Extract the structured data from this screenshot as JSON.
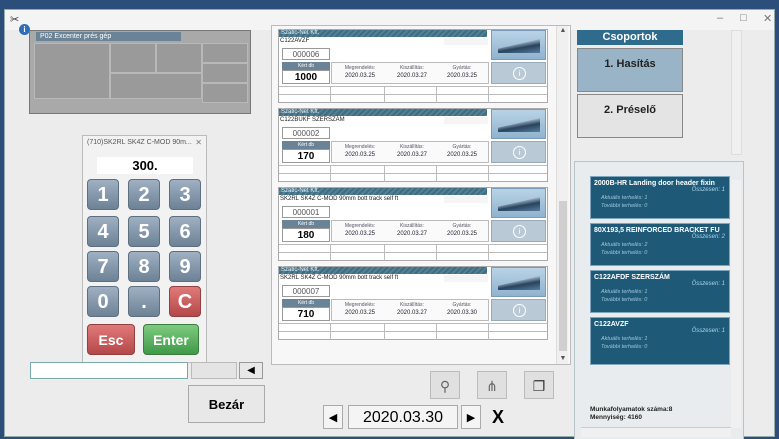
{
  "window": {
    "minimize_glyph": "–",
    "maximize_glyph": "□",
    "close_glyph": "✕"
  },
  "machine": {
    "title": "P02 Excenter prés gép"
  },
  "keypad": {
    "title": "(710)SK2RL SK4Z C-MOD 90m...",
    "close_glyph": "✕",
    "display": "300.",
    "keys": [
      "1",
      "2",
      "3",
      "4",
      "5",
      "6",
      "7",
      "8",
      "9",
      "0",
      ".",
      "C"
    ],
    "esc_label": "Esc",
    "enter_label": "Enter"
  },
  "controls": {
    "left_arrow": "◀",
    "close_label": "Bezár"
  },
  "orders": [
    {
      "company": "Szatic-Net Kft.",
      "product": "C122AVZF",
      "number": "000006",
      "qty_label": "Kért db",
      "qty": "1000",
      "order_label": "Megrendelés:",
      "order_date": "2020.03.25",
      "ship_label": "Kiszállítás:",
      "ship_date": "2020.03.27",
      "prod_label": "Gyártás:",
      "prod_date": "2020.03.25"
    },
    {
      "company": "Szatic-Net Kft.",
      "product": "C122BUKF SZERSZÁM",
      "number": "000002",
      "qty_label": "Kért db",
      "qty": "170",
      "order_label": "Megrendelés:",
      "order_date": "2020.03.25",
      "ship_label": "Kiszállítás:",
      "ship_date": "2020.03.27",
      "prod_label": "Gyártás:",
      "prod_date": "2020.03.25"
    },
    {
      "company": "Szatic-Net Kft.",
      "product": "SK2RL SK4Z C-MOD 90mm bott track self ft",
      "number": "000001",
      "qty_label": "Kért db",
      "qty": "180",
      "order_label": "Megrendelés:",
      "order_date": "2020.03.25",
      "ship_label": "Kiszállítás:",
      "ship_date": "2020.03.27",
      "prod_label": "Gyártás:",
      "prod_date": "2020.03.25"
    },
    {
      "company": "Szatic-Net Kft.",
      "product": "SK2RL SK4Z C-MOD 90mm bott track self ft",
      "number": "000007",
      "qty_label": "Kért db",
      "qty": "710",
      "order_label": "Megrendelés:",
      "order_date": "2020.03.25",
      "ship_label": "Kiszállítás:",
      "ship_date": "2020.03.27",
      "prod_label": "Gyártás:",
      "prod_date": "2020.03.30"
    }
  ],
  "toolbar": {
    "date": "2020.03.30",
    "prev_glyph": "◀",
    "next_glyph": "▶",
    "clear_glyph": "X"
  },
  "groups": {
    "title": "Csoportok",
    "items": [
      "1. Hasítás",
      "2. Préselő"
    ]
  },
  "workflows": {
    "items": [
      {
        "name": "2000B-HR Landing door header fixin",
        "total": "Összesen: 1",
        "current": "Aktuális terhelés: 1",
        "next": "További terhelés: 0"
      },
      {
        "name": "80X193,5 REINFORCED BRACKET FU",
        "total": "Összesen: 2",
        "current": "Aktuális terhelés: 2",
        "next": "További terhelés: 0"
      },
      {
        "name": "C122AFDF SZERSZÁM",
        "total": "Összesen: 1",
        "current": "Aktuális terhelés: 1",
        "next": "További terhelés: 0"
      },
      {
        "name": "C122AVZF",
        "total": "Összesen: 1",
        "current": "Aktuális terhelés: 1",
        "next": "További terhelés: 0"
      }
    ],
    "summary_count": "Munkafolyamatok száma:8",
    "summary_qty": "Mennyiség: 4160"
  }
}
